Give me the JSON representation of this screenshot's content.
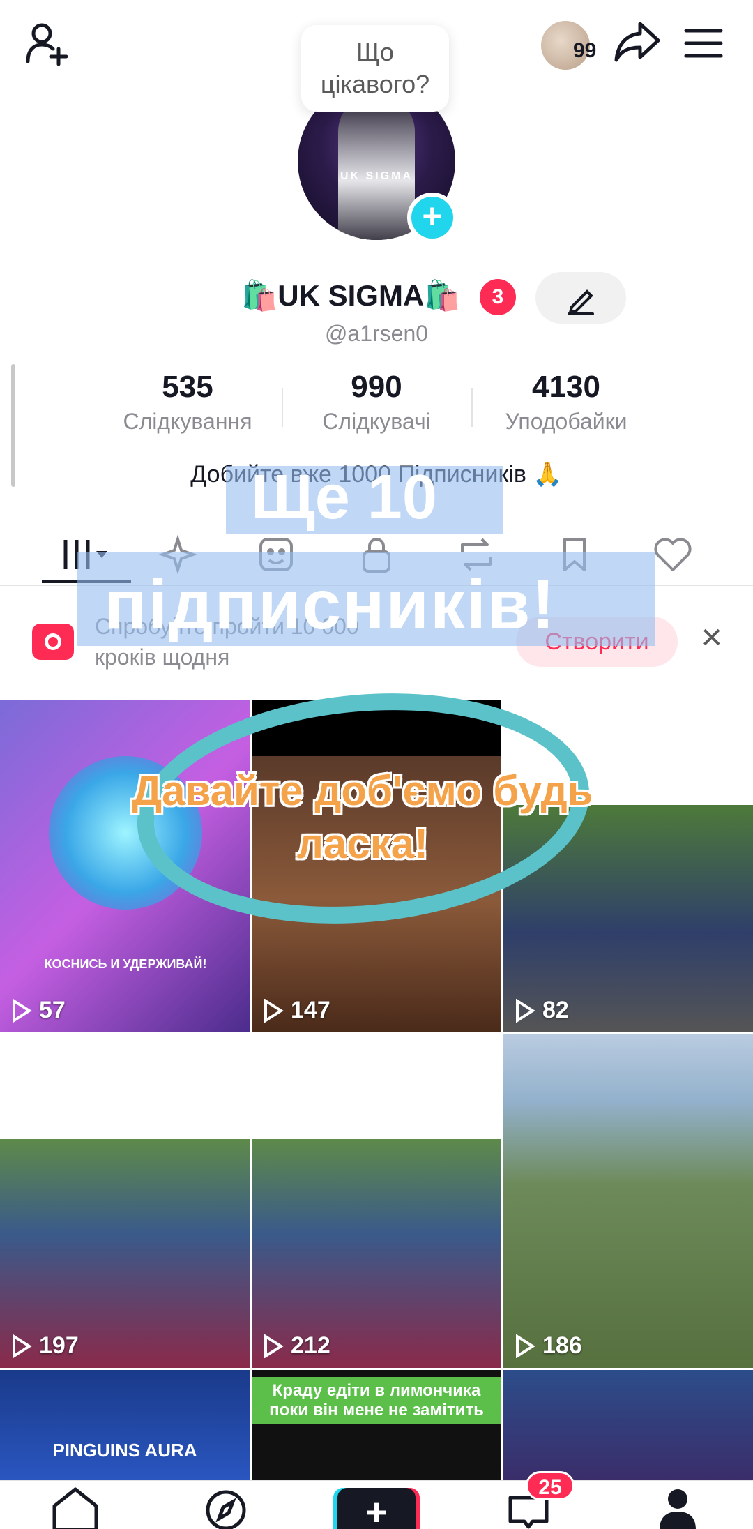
{
  "topbar": {
    "bubble_text": "Що цікавого?",
    "coins": "99"
  },
  "profile": {
    "avatar_tag": "UK SIGMA",
    "name": "🛍️UK SIGMA🛍️",
    "notifications": "3",
    "handle": "@a1rsen0",
    "bio": "Добийте вже 1000 Підписників 🙏"
  },
  "stats": [
    {
      "value": "535",
      "label": "Слідкування"
    },
    {
      "value": "990",
      "label": "Слідкувачі"
    },
    {
      "value": "4130",
      "label": "Уподобайки"
    }
  ],
  "tabs": [
    "videos",
    "sparkle",
    "sticker",
    "private",
    "repost",
    "saved",
    "liked"
  ],
  "banner": {
    "text": "Спробуйте пройти 10 000 кроків щодня",
    "create_label": "Створити"
  },
  "grid": [
    {
      "views": "57",
      "caption": "КОСНИСЬ И УДЕРЖИВАЙ!"
    },
    {
      "views": "147"
    },
    {
      "views": "82"
    },
    {
      "views": "197"
    },
    {
      "views": "212"
    },
    {
      "views": "186"
    },
    {
      "label": "PINGUINS AURA"
    },
    {
      "label": "Краду едіти в лимончика поки він мене не замітить"
    },
    {}
  ],
  "overlay": {
    "line1": "Ще 10",
    "line2": "підписників!",
    "line3": "Давайте доб'ємо будь ласка!"
  },
  "bottom_nav": {
    "inbox_badge": "25"
  }
}
